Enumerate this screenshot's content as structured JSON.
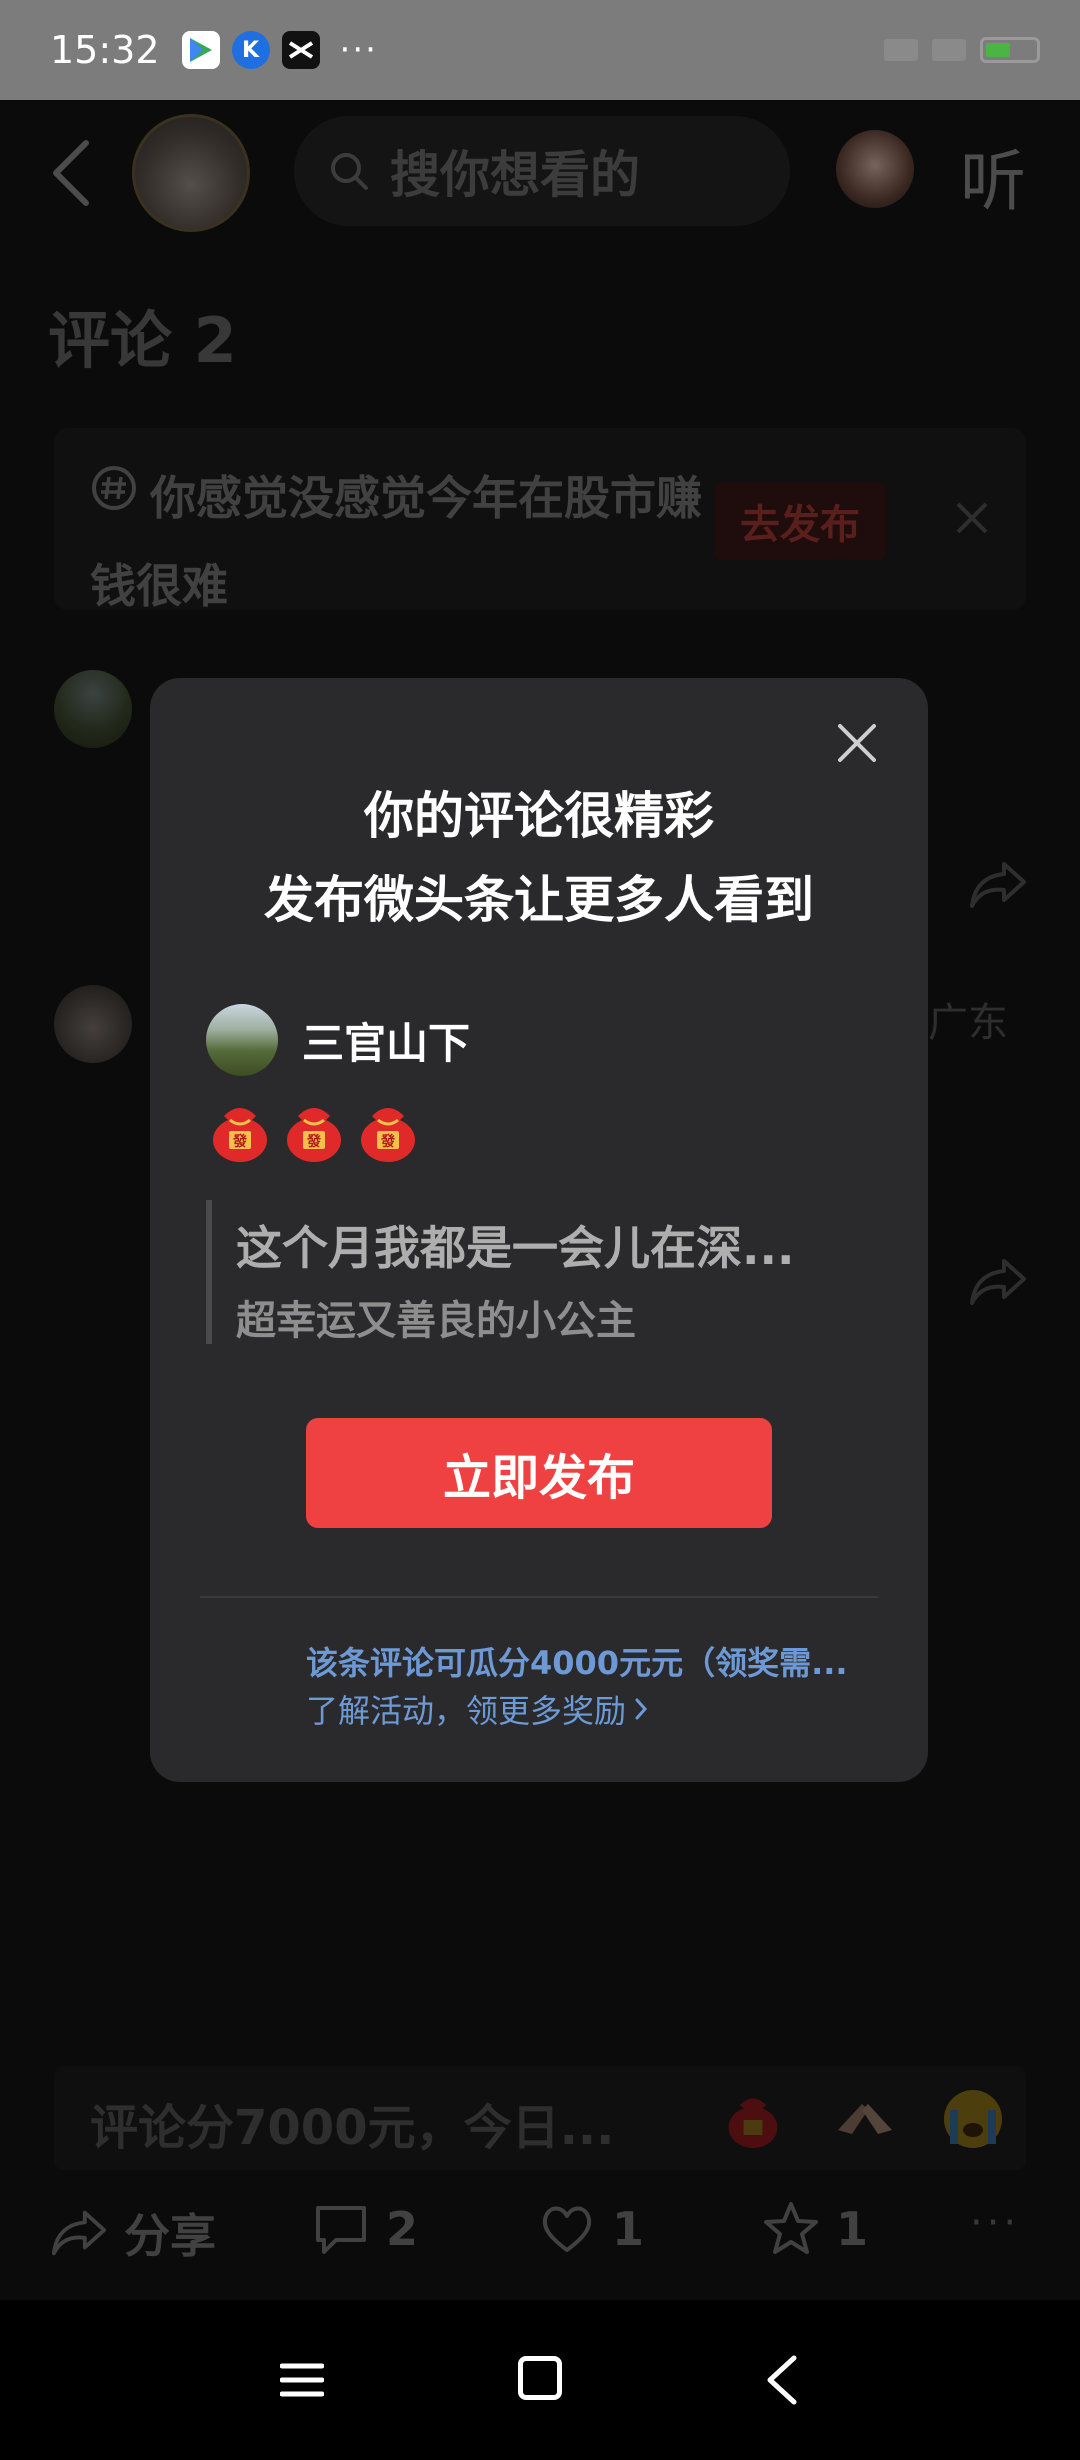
{
  "status_bar": {
    "time": "15:32",
    "app_icons": [
      "google-play-icon",
      "k-app-icon",
      "capcut-icon"
    ],
    "more": "···"
  },
  "nav": {
    "search_placeholder": "搜你想看的",
    "listen_label": "听"
  },
  "comments": {
    "title": "评论 2",
    "topic_text": "你感觉没感觉今年在股市赚钱很难",
    "topic_button": "去发布",
    "region": "广东"
  },
  "modal": {
    "title_line1": "你的评论很精彩",
    "title_line2": "发布微头条让更多人看到",
    "author": "三官山下",
    "quote_text": "这个月我都是一会儿在深...",
    "quote_sub": "超幸运又善良的小公主",
    "publish_button": "立即发布",
    "reward_text": "该条评论可瓜分4000元元（领奖需...",
    "reward_link": "了解活动，领更多奖励"
  },
  "bottom_bar": {
    "comment_placeholder": "评论分7000元，今日...",
    "share_label": "分享",
    "comment_count": "2",
    "like_count": "1",
    "favorite_count": "1",
    "more": "···"
  },
  "colors": {
    "accent_red": "#f04142",
    "link_blue": "#6d9ad6",
    "modal_bg": "#2a2a2c",
    "page_bg": "#141414"
  }
}
